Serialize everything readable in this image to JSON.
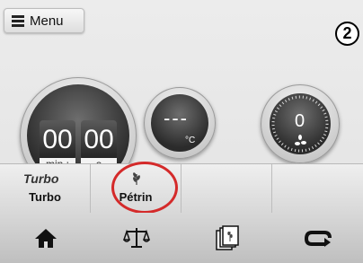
{
  "menu": {
    "label": "Menu"
  },
  "step_badge": "2",
  "timer": {
    "minutes": "00",
    "seconds": "00",
    "min_unit": "min",
    "sec_unit": "s",
    "separator": ":"
  },
  "temperature": {
    "value": "---",
    "unit": "°C"
  },
  "fan": {
    "value": "0"
  },
  "tabs": [
    {
      "logo": "Turbo",
      "label": "Turbo"
    },
    {
      "label": "Pétrin"
    },
    {
      "label": ""
    },
    {
      "label": ""
    }
  ],
  "bottom_nav": [
    {
      "icon": "home-icon"
    },
    {
      "icon": "scale-icon"
    },
    {
      "icon": "recipe-cards-icon"
    },
    {
      "icon": "return-icon"
    }
  ],
  "colors": {
    "highlight": "#d42a2a"
  }
}
